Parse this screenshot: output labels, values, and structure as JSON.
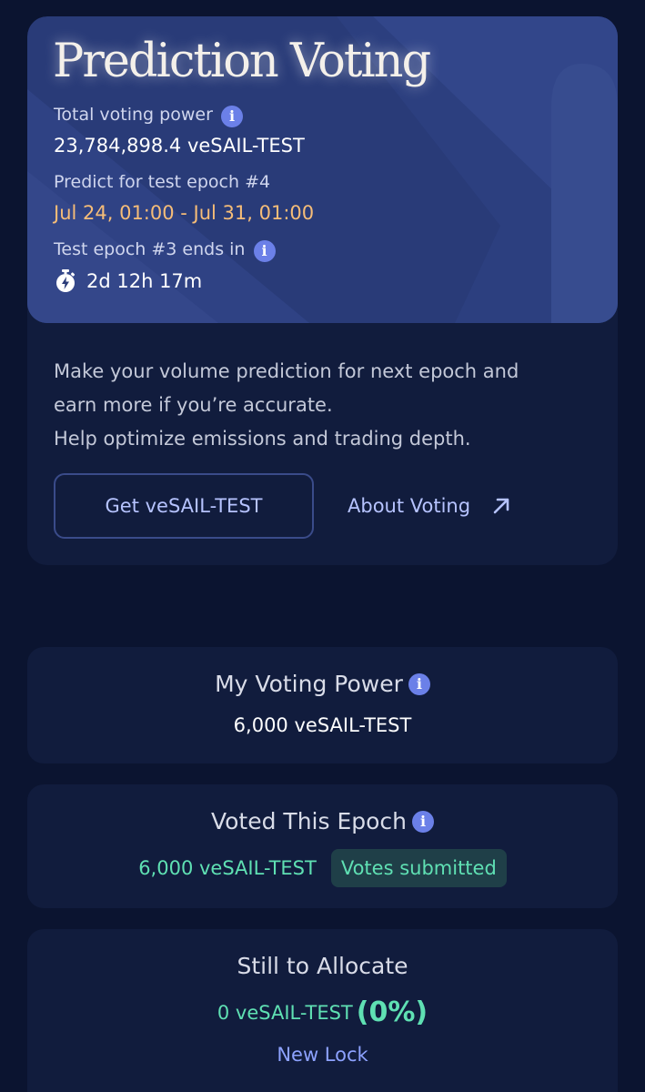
{
  "hero": {
    "title": "Prediction Voting",
    "total_power_label": "Total voting power",
    "total_power_value": "23,784,898.4 veSAIL-TEST",
    "predict_label": "Predict for test epoch #4",
    "predict_dates": "Jul 24, 01:00 - Jul 31, 01:00",
    "ends_label": "Test epoch #3 ends in",
    "ends_value": "2d 12h 17m"
  },
  "description": {
    "line1": "Make your volume prediction for next epoch and",
    "line2": "earn more if you’re accurate.",
    "line3": "Help optimize emissions and trading depth."
  },
  "actions": {
    "get_label": "Get veSAIL-TEST",
    "about_label": "About Voting"
  },
  "my_power": {
    "title": "My Voting Power",
    "value": "6,000 veSAIL-TEST"
  },
  "voted": {
    "title": "Voted This Epoch",
    "value": "6,000 veSAIL-TEST",
    "badge": "Votes submitted"
  },
  "allocate": {
    "title": "Still to Allocate",
    "value": "0 veSAIL-TEST",
    "percent": "(0%)",
    "new_lock": "New Lock"
  },
  "icons": {
    "info": "info-icon",
    "timer": "stopwatch-icon",
    "external": "arrow-up-right-icon"
  },
  "colors": {
    "page_bg": "#0b1430",
    "card_bg": "#111c3d",
    "hero_bg": "#293b78",
    "accent": "#b6c3ff",
    "date_orange": "#f6bd78",
    "success_green": "#5fe0b3",
    "info_blue": "#6b80e8"
  }
}
